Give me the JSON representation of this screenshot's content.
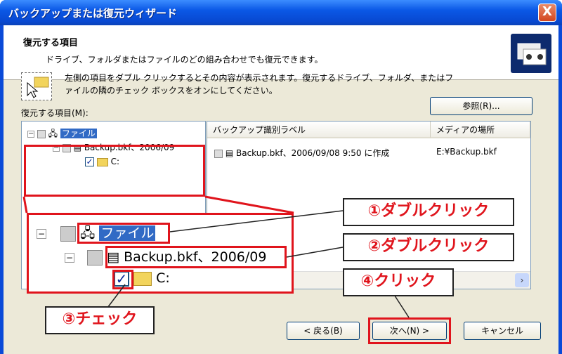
{
  "window": {
    "title": "バックアップまたは復元ウィザード",
    "close_label": "X"
  },
  "header": {
    "title": "復元する項目",
    "subtitle": "ドライブ、フォルダまたはファイルのどの組み合わせでも復元できます。"
  },
  "instructions": "左側の項目をダブル クリックするとその内容が表示されます。復元するドライブ、フォルダ、またはファイルの隣のチェック ボックスをオンにしてください。",
  "items_label": "復元する項目(M):",
  "browse_label": "参照(R)...",
  "tree": {
    "root": "ファイル",
    "backup": "Backup.bkf、2006/09",
    "drive": "C:"
  },
  "list": {
    "columns": [
      "バックアップ識別ラベル",
      "メディアの場所"
    ],
    "rows": [
      {
        "label": "Backup.bkf、2006/09/08 9:50 に作成",
        "location": "E:¥Backup.bkf"
      }
    ]
  },
  "zoom": {
    "root": "ファイル",
    "backup": "Backup.bkf、2006/09",
    "drive": "C:"
  },
  "callouts": {
    "c1": "①ダブルクリック",
    "c2": "②ダブルクリック",
    "c3": "③チェック",
    "c4": "④クリック"
  },
  "buttons": {
    "back": "< 戻る(B)",
    "next": "次へ(N) >",
    "cancel": "キャンセル"
  },
  "colors": {
    "title_bar": "#0a58e6",
    "annotation": "#e0141c",
    "selection": "#316ac5"
  }
}
